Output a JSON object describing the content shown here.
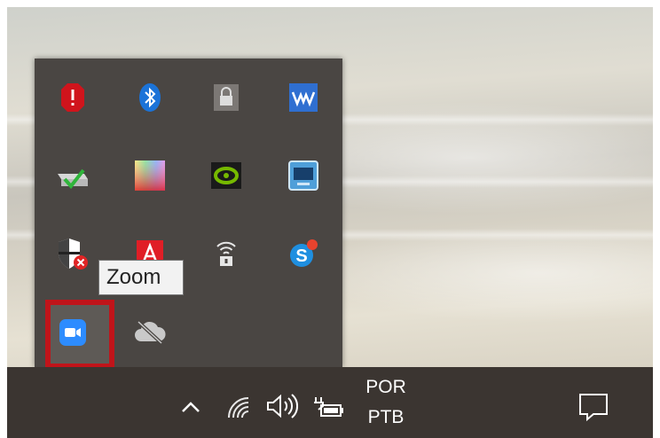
{
  "tooltip": {
    "text": "Zoom"
  },
  "language": {
    "line1": "POR",
    "line2": "PTB"
  },
  "tray_icons": [
    "security-alert-icon",
    "bluetooth-icon",
    "lock-icon",
    "waves-audio-icon",
    "printer-check-icon",
    "color-palette-icon",
    "nvidia-icon",
    "monitor-app-icon",
    "defender-shield-icon",
    "adobe-icon",
    "wifi-lock-icon",
    "skype-icon",
    "zoom-icon",
    "onedrive-offline-icon"
  ],
  "taskbar_icons": [
    "chevron-up-icon",
    "network-icon",
    "volume-icon",
    "battery-icon",
    "action-center-icon"
  ],
  "colors": {
    "tray_background": "#4a4643",
    "taskbar_background": "#3b3531",
    "highlight_border": "#c0141a",
    "zoom_blue": "#2d8cff"
  }
}
